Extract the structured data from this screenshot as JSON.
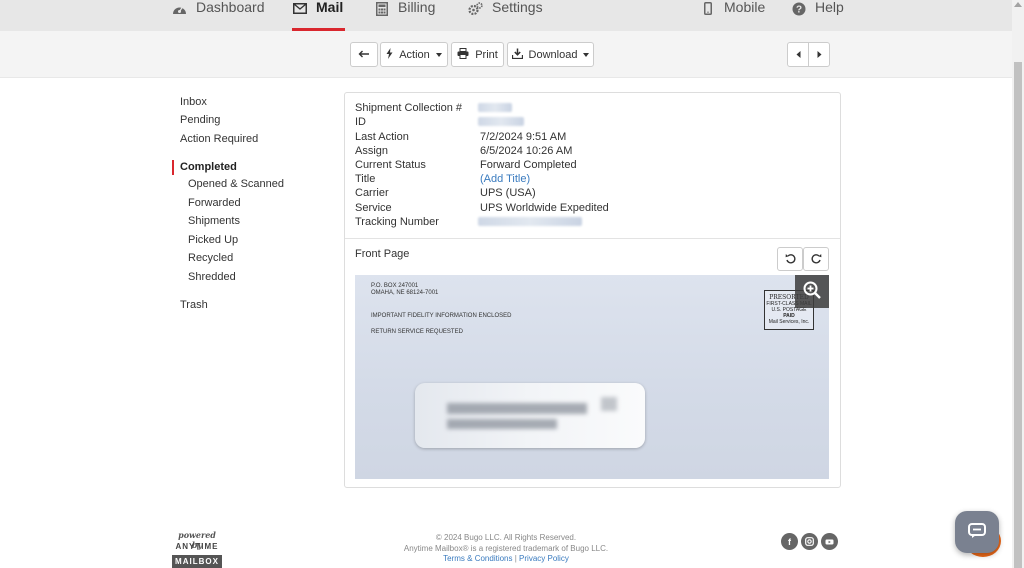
{
  "nav": {
    "dashboard": "Dashboard",
    "mail": "Mail",
    "billing": "Billing",
    "settings": "Settings",
    "mobile": "Mobile",
    "help": "Help"
  },
  "toolbar": {
    "action": "Action",
    "print": "Print",
    "download": "Download"
  },
  "sidebar": {
    "inbox": "Inbox",
    "pending": "Pending",
    "action_required": "Action Required",
    "completed": "Completed",
    "opened_scanned": "Opened & Scanned",
    "forwarded": "Forwarded",
    "shipments": "Shipments",
    "picked_up": "Picked Up",
    "recycled": "Recycled",
    "shredded": "Shredded",
    "trash": "Trash"
  },
  "details": {
    "labels": {
      "collection": "Shipment Collection #",
      "id": "ID",
      "last_action": "Last Action",
      "assign": "Assign",
      "current_status": "Current Status",
      "title": "Title",
      "carrier": "Carrier",
      "service": "Service",
      "tracking": "Tracking Number"
    },
    "values": {
      "last_action": "7/2/2024 9:51 AM",
      "assign": "6/5/2024 10:26 AM",
      "current_status": "Forward Completed",
      "title": "(Add Title)",
      "carrier": "UPS (USA)",
      "service": "UPS Worldwide Expedited"
    }
  },
  "scan": {
    "label": "Front Page",
    "envelope": {
      "return_line1": "P.O. BOX 247001",
      "return_line2": "OMAHA, NE 68124-7001",
      "notice": "IMPORTANT FIDELITY INFORMATION ENCLOSED",
      "return_service": "RETURN SERVICE REQUESTED",
      "stamp_line1": "PRESORTED",
      "stamp_line2": "FIRST-CLASS MAIL",
      "stamp_line3": "U.S. POSTAGE",
      "stamp_line4": "PAID",
      "stamp_line5": "Mail Services, Inc."
    }
  },
  "footer": {
    "copyright": "© 2024 Bugo LLC. All Rights Reserved.",
    "trademark": "Anytime Mailbox® is a registered trademark of Bugo LLC.",
    "terms": "Terms & Conditions",
    "separator": "|",
    "privacy": "Privacy Policy",
    "powered_by": "powered by",
    "logo_top": "ANYTIME",
    "logo_bottom": "MAILBOX"
  },
  "colors": {
    "accent": "#d9272e",
    "link": "#3a7bbf",
    "chat_accent": "#ee6a1a"
  }
}
